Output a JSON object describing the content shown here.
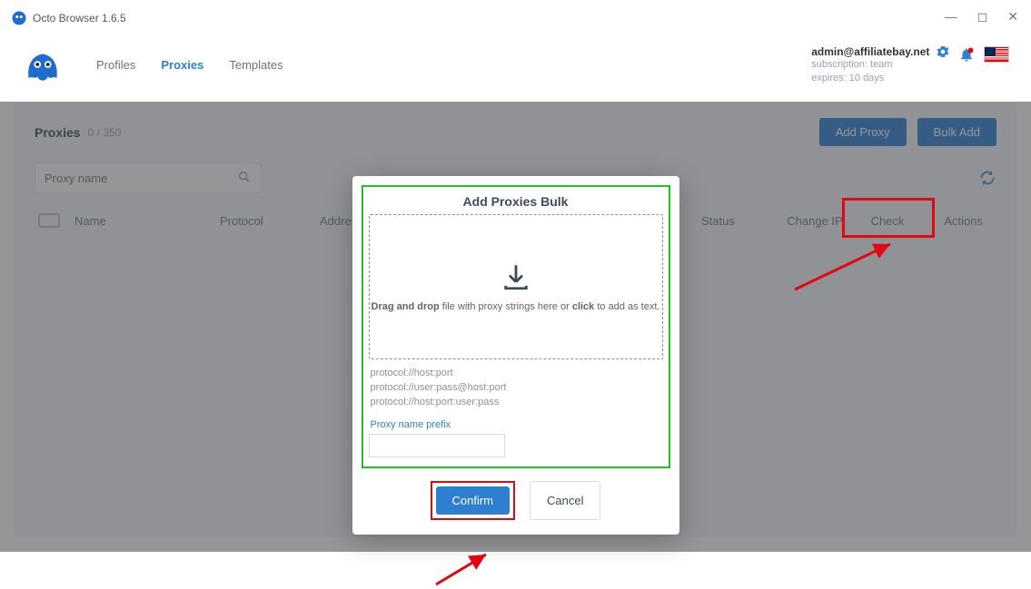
{
  "window": {
    "title": "Octo Browser 1.6.5"
  },
  "nav": {
    "items": [
      "Profiles",
      "Proxies",
      "Templates"
    ],
    "active_index": 1
  },
  "account": {
    "email": "admin@affiliatebay.net",
    "subscription": "subscription: team",
    "expires": "expires: 10 days"
  },
  "icons": {
    "search": "search-icon",
    "refresh": "refresh-icon",
    "download": "download-icon",
    "gear": "gear-icon",
    "bell": "bell-icon",
    "flag_us": "flag-us"
  },
  "panel": {
    "title": "Proxies",
    "count": "0 / 350",
    "search_placeholder": "Proxy name",
    "buttons": {
      "add": "Add Proxy",
      "bulk": "Bulk Add"
    },
    "columns": {
      "name": "Name",
      "protocol": "Protocol",
      "address": "Address",
      "status": "Status",
      "change_ip": "Change IP",
      "check": "Check",
      "actions": "Actions"
    }
  },
  "modal": {
    "title": "Add Proxies Bulk",
    "drop_bold1": "Drag and drop",
    "drop_mid": " file with proxy strings here or ",
    "drop_bold2": "click",
    "drop_end": " to add as text.",
    "example1": "protocol://host:port",
    "example2": "protocol://user:pass@host:port",
    "example3": "protocol://host:port:user:pass",
    "prefix_label": "Proxy name prefix",
    "confirm": "Confirm",
    "cancel": "Cancel"
  },
  "colors": {
    "primary": "#2e7fd2",
    "highlight_green": "#22c321",
    "highlight_red": "#e30613"
  }
}
